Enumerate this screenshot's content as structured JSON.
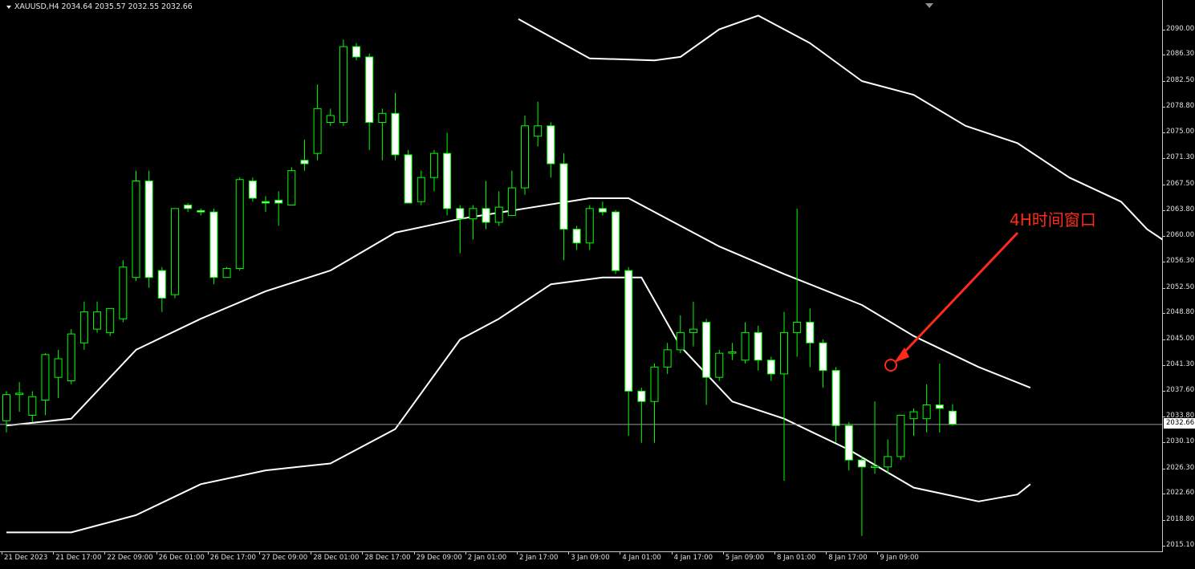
{
  "window": {
    "symbol": "XAUUSD,H4",
    "ohlc": "2034.64 2035.57 2032.55 2032.66"
  },
  "colors": {
    "background": "#000000",
    "bull_candle": "#000000",
    "bear_candle": "#ffffff",
    "wick": "#00ff00",
    "bands": "#ffffff",
    "annotation": "#ff2a1a",
    "axis_text": "#e0e0e0"
  },
  "price_axis": {
    "ticks": [
      "2090.00",
      "2086.30",
      "2082.50",
      "2078.80",
      "2075.00",
      "2071.30",
      "2067.50",
      "2063.80",
      "2060.00",
      "2056.30",
      "2052.50",
      "2048.80",
      "2045.00",
      "2041.30",
      "2037.60",
      "2033.80",
      "2030.10",
      "2026.30",
      "2022.60",
      "2018.80",
      "2015.10"
    ],
    "current_price_label": "2032.66"
  },
  "time_axis": {
    "labels": [
      "21 Dec 2023",
      "21 Dec 17:00",
      "22 Dec 09:00",
      "26 Dec 01:00",
      "26 Dec 17:00",
      "27 Dec 09:00",
      "28 Dec 01:00",
      "28 Dec 17:00",
      "29 Dec 09:00",
      "2 Jan 01:00",
      "2 Jan 17:00",
      "3 Jan 09:00",
      "4 Jan 01:00",
      "4 Jan 17:00",
      "5 Jan 09:00",
      "8 Jan 01:00",
      "8 Jan 17:00",
      "9 Jan 09:00"
    ]
  },
  "annotation": {
    "label": "4H时间窗口"
  },
  "chart_data": {
    "type": "candlestick",
    "symbol": "XAUUSD",
    "timeframe": "H4",
    "ylim": [
      2014.6,
      2091.7
    ],
    "current_price": 2032.66,
    "candles": [
      {
        "o": 2033.2,
        "h": 2037.5,
        "l": 2031.5,
        "c": 2037.0
      },
      {
        "o": 2037.0,
        "h": 2038.8,
        "l": 2034.5,
        "c": 2037.2
      },
      {
        "o": 2034.0,
        "h": 2037.5,
        "l": 2033.0,
        "c": 2036.7
      },
      {
        "o": 2036.2,
        "h": 2043.0,
        "l": 2034.0,
        "c": 2042.8
      },
      {
        "o": 2039.5,
        "h": 2043.5,
        "l": 2036.5,
        "c": 2042.2
      },
      {
        "o": 2039.0,
        "h": 2046.5,
        "l": 2038.5,
        "c": 2045.8
      },
      {
        "o": 2044.5,
        "h": 2050.5,
        "l": 2043.5,
        "c": 2049.0
      },
      {
        "o": 2046.5,
        "h": 2050.5,
        "l": 2046.0,
        "c": 2049.0
      },
      {
        "o": 2046.0,
        "h": 2049.5,
        "l": 2045.5,
        "c": 2049.5
      },
      {
        "o": 2048.0,
        "h": 2056.5,
        "l": 2047.5,
        "c": 2055.5
      },
      {
        "o": 2054.0,
        "h": 2069.5,
        "l": 2053.5,
        "c": 2068.0
      },
      {
        "o": 2068.0,
        "h": 2069.5,
        "l": 2052.5,
        "c": 2054.0
      },
      {
        "o": 2055.0,
        "h": 2055.5,
        "l": 2049.0,
        "c": 2051.0
      },
      {
        "o": 2051.5,
        "h": 2064.0,
        "l": 2051.0,
        "c": 2064.0
      },
      {
        "o": 2064.5,
        "h": 2064.8,
        "l": 2063.5,
        "c": 2064.0
      },
      {
        "o": 2063.7,
        "h": 2064.0,
        "l": 2063.0,
        "c": 2063.5
      },
      {
        "o": 2063.5,
        "h": 2064.0,
        "l": 2053.0,
        "c": 2054.0
      },
      {
        "o": 2054.0,
        "h": 2055.5,
        "l": 2054.0,
        "c": 2055.3
      },
      {
        "o": 2055.3,
        "h": 2068.5,
        "l": 2055.0,
        "c": 2068.2
      },
      {
        "o": 2068.0,
        "h": 2068.5,
        "l": 2065.0,
        "c": 2065.5
      },
      {
        "o": 2065.0,
        "h": 2065.8,
        "l": 2063.5,
        "c": 2064.8
      },
      {
        "o": 2065.2,
        "h": 2066.5,
        "l": 2061.5,
        "c": 2064.8
      },
      {
        "o": 2064.5,
        "h": 2070.0,
        "l": 2064.5,
        "c": 2069.5
      },
      {
        "o": 2071.0,
        "h": 2074.0,
        "l": 2069.5,
        "c": 2070.5
      },
      {
        "o": 2072.0,
        "h": 2082.0,
        "l": 2071.0,
        "c": 2078.5
      },
      {
        "o": 2076.5,
        "h": 2078.5,
        "l": 2076.0,
        "c": 2077.5
      },
      {
        "o": 2076.5,
        "h": 2088.5,
        "l": 2076.0,
        "c": 2087.5
      },
      {
        "o": 2087.5,
        "h": 2088.0,
        "l": 2085.5,
        "c": 2086.0
      },
      {
        "o": 2086.0,
        "h": 2086.5,
        "l": 2072.5,
        "c": 2076.5
      },
      {
        "o": 2076.5,
        "h": 2078.5,
        "l": 2071.0,
        "c": 2077.8
      },
      {
        "o": 2077.8,
        "h": 2080.8,
        "l": 2071.0,
        "c": 2071.8
      },
      {
        "o": 2071.8,
        "h": 2072.5,
        "l": 2065.0,
        "c": 2064.8
      },
      {
        "o": 2065.0,
        "h": 2069.5,
        "l": 2064.5,
        "c": 2068.5
      },
      {
        "o": 2068.5,
        "h": 2072.5,
        "l": 2066.5,
        "c": 2072.0
      },
      {
        "o": 2072.0,
        "h": 2075.0,
        "l": 2063.0,
        "c": 2064.0
      },
      {
        "o": 2064.0,
        "h": 2064.5,
        "l": 2057.5,
        "c": 2062.5
      },
      {
        "o": 2062.5,
        "h": 2064.5,
        "l": 2059.5,
        "c": 2064.0
      },
      {
        "o": 2064.0,
        "h": 2068.0,
        "l": 2061.0,
        "c": 2062.0
      },
      {
        "o": 2062.0,
        "h": 2066.5,
        "l": 2061.5,
        "c": 2064.2
      },
      {
        "o": 2063.0,
        "h": 2069.5,
        "l": 2063.0,
        "c": 2067.0
      },
      {
        "o": 2067.0,
        "h": 2077.5,
        "l": 2066.0,
        "c": 2076.0
      },
      {
        "o": 2074.5,
        "h": 2079.5,
        "l": 2073.0,
        "c": 2076.0
      },
      {
        "o": 2076.0,
        "h": 2076.5,
        "l": 2068.5,
        "c": 2070.5
      },
      {
        "o": 2070.5,
        "h": 2072.0,
        "l": 2056.5,
        "c": 2061.0
      },
      {
        "o": 2061.0,
        "h": 2061.5,
        "l": 2058.0,
        "c": 2059.0
      },
      {
        "o": 2059.0,
        "h": 2064.5,
        "l": 2058.0,
        "c": 2064.0
      },
      {
        "o": 2064.0,
        "h": 2065.0,
        "l": 2063.0,
        "c": 2063.5
      },
      {
        "o": 2063.5,
        "h": 2063.8,
        "l": 2054.5,
        "c": 2055.0
      },
      {
        "o": 2055.0,
        "h": 2055.5,
        "l": 2031.0,
        "c": 2037.5
      },
      {
        "o": 2037.5,
        "h": 2038.0,
        "l": 2030.0,
        "c": 2036.0
      },
      {
        "o": 2036.0,
        "h": 2041.5,
        "l": 2030.0,
        "c": 2041.0
      },
      {
        "o": 2041.0,
        "h": 2044.5,
        "l": 2040.0,
        "c": 2043.5
      },
      {
        "o": 2043.5,
        "h": 2048.5,
        "l": 2043.0,
        "c": 2046.0
      },
      {
        "o": 2046.0,
        "h": 2050.5,
        "l": 2044.0,
        "c": 2046.5
      },
      {
        "o": 2047.5,
        "h": 2048.0,
        "l": 2035.5,
        "c": 2039.5
      },
      {
        "o": 2039.5,
        "h": 2043.5,
        "l": 2039.0,
        "c": 2043.0
      },
      {
        "o": 2043.0,
        "h": 2044.5,
        "l": 2042.0,
        "c": 2043.2
      },
      {
        "o": 2042.0,
        "h": 2047.5,
        "l": 2041.5,
        "c": 2046.0
      },
      {
        "o": 2046.0,
        "h": 2047.0,
        "l": 2040.5,
        "c": 2042.0
      },
      {
        "o": 2042.0,
        "h": 2042.5,
        "l": 2039.0,
        "c": 2040.0
      },
      {
        "o": 2040.0,
        "h": 2049.0,
        "l": 2024.5,
        "c": 2046.0
      },
      {
        "o": 2046.0,
        "h": 2064.0,
        "l": 2042.5,
        "c": 2047.5
      },
      {
        "o": 2047.5,
        "h": 2049.5,
        "l": 2041.0,
        "c": 2044.5
      },
      {
        "o": 2044.5,
        "h": 2045.0,
        "l": 2038.0,
        "c": 2040.5
      },
      {
        "o": 2040.5,
        "h": 2041.0,
        "l": 2030.0,
        "c": 2032.5
      },
      {
        "o": 2032.5,
        "h": 2033.0,
        "l": 2026.0,
        "c": 2027.5
      },
      {
        "o": 2027.5,
        "h": 2028.0,
        "l": 2016.5,
        "c": 2026.5
      },
      {
        "o": 2026.5,
        "h": 2036.0,
        "l": 2025.5,
        "c": 2026.6
      },
      {
        "o": 2026.5,
        "h": 2030.5,
        "l": 2025.5,
        "c": 2028.0
      },
      {
        "o": 2028.0,
        "h": 2034.0,
        "l": 2027.5,
        "c": 2034.0
      },
      {
        "o": 2033.5,
        "h": 2035.0,
        "l": 2031.0,
        "c": 2034.5
      },
      {
        "o": 2033.5,
        "h": 2038.5,
        "l": 2031.5,
        "c": 2035.5
      },
      {
        "o": 2035.5,
        "h": 2041.5,
        "l": 2031.5,
        "c": 2035.0
      },
      {
        "o": 2034.6,
        "h": 2035.6,
        "l": 2032.5,
        "c": 2032.7
      }
    ],
    "bands": {
      "upper": [
        [
          0,
          null
        ],
        [
          40,
          2091.5
        ],
        [
          45,
          2085.8
        ],
        [
          50,
          2085.5
        ],
        [
          52,
          2086.0
        ],
        [
          55,
          2090.0
        ],
        [
          58,
          2092.0
        ],
        [
          62,
          2088.0
        ],
        [
          66,
          2082.5
        ],
        [
          70,
          2080.5
        ],
        [
          74,
          2076.0
        ],
        [
          78,
          2073.5
        ],
        [
          82,
          2068.5
        ],
        [
          86,
          2065.0
        ],
        [
          88,
          2061.0
        ],
        [
          90,
          2058.5
        ],
        [
          93,
          2053.5
        ]
      ],
      "middle": [
        [
          0,
          2032.5
        ],
        [
          5,
          2033.5
        ],
        [
          10,
          2043.5
        ],
        [
          15,
          2048.0
        ],
        [
          20,
          2052.0
        ],
        [
          25,
          2055.0
        ],
        [
          30,
          2060.5
        ],
        [
          35,
          2062.5
        ],
        [
          40,
          2064.0
        ],
        [
          45,
          2065.5
        ],
        [
          48,
          2065.5
        ],
        [
          51,
          2062.5
        ],
        [
          55,
          2058.5
        ],
        [
          60,
          2054.5
        ],
        [
          66,
          2050.0
        ],
        [
          70,
          2045.5
        ],
        [
          75,
          2041.0
        ],
        [
          79,
          2038.0
        ]
      ],
      "lower": [
        [
          0,
          2017.0
        ],
        [
          5,
          2017.0
        ],
        [
          10,
          2019.5
        ],
        [
          15,
          2024.0
        ],
        [
          20,
          2026.0
        ],
        [
          25,
          2027.0
        ],
        [
          30,
          2032.0
        ],
        [
          35,
          2045.0
        ],
        [
          38,
          2048.0
        ],
        [
          42,
          2053.0
        ],
        [
          46,
          2054.0
        ],
        [
          49,
          2054.0
        ],
        [
          52,
          2044.0
        ],
        [
          56,
          2036.0
        ],
        [
          60,
          2033.5
        ],
        [
          65,
          2029.0
        ],
        [
          70,
          2023.5
        ],
        [
          75,
          2021.5
        ],
        [
          78,
          2022.5
        ],
        [
          79,
          2024.0
        ]
      ]
    }
  }
}
